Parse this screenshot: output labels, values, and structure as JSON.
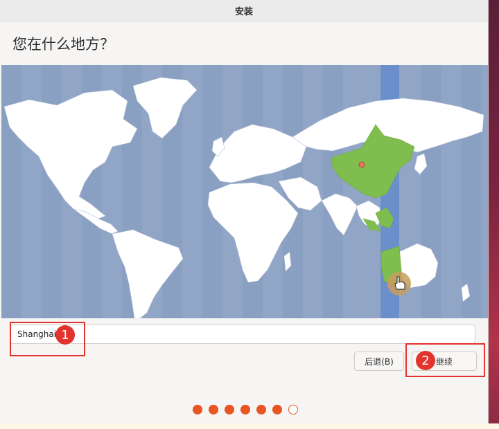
{
  "window": {
    "title": "安装"
  },
  "page": {
    "heading": "您在什么地方？"
  },
  "timezone": {
    "value": "Shanghai"
  },
  "buttons": {
    "back": "后退(B)",
    "continue": "继续"
  },
  "annotations": [
    {
      "label": "1"
    },
    {
      "label": "2"
    }
  ],
  "progress": {
    "total": 7,
    "completed": 6
  },
  "colors": {
    "ocean": "#91a6c7",
    "land": "#ffffff",
    "selected_region": "#80bd4f",
    "timezone_band": "#6b8fcb",
    "accent": "#e95420",
    "annotation": "#e2332d"
  },
  "map": {
    "selected_timezone_label": "Asia/Shanghai",
    "cursor_icon": "hand-pointer-icon"
  }
}
